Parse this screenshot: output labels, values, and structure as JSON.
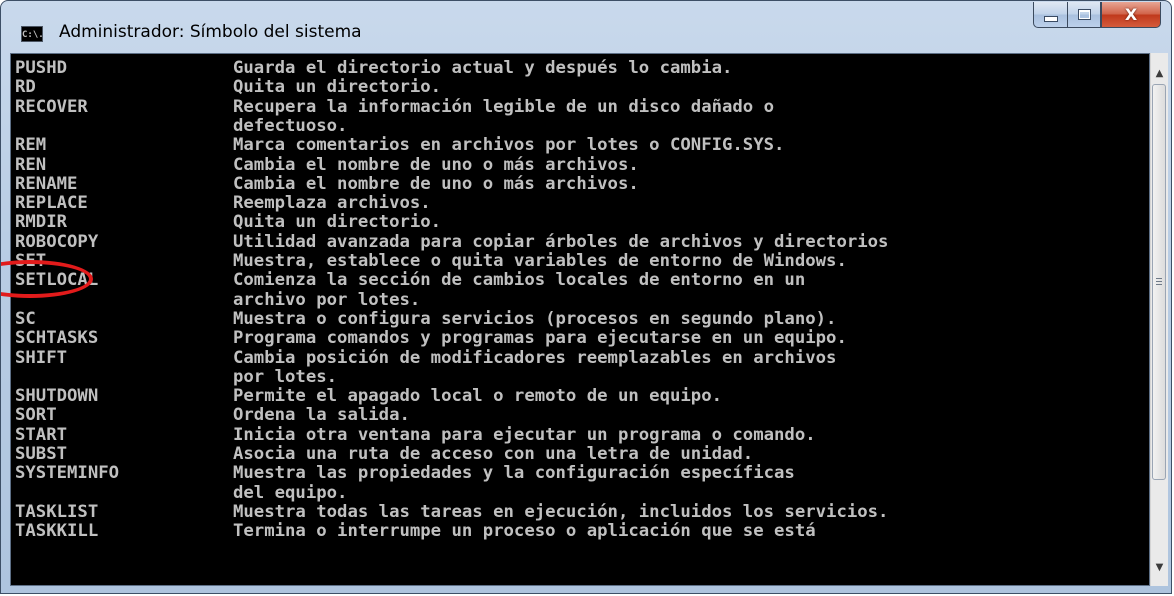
{
  "window": {
    "title": "Administrador: Símbolo del sistema",
    "icon": "cmd-app-icon",
    "icon_text": "C:\\.",
    "minimize_icon": "minimize-icon",
    "maximize_icon": "maximize-icon",
    "close_label": "X"
  },
  "console": {
    "lines": [
      {
        "cmd": "PUSHD",
        "desc": "Guarda el directorio actual y después lo cambia."
      },
      {
        "cmd": "RD",
        "desc": "Quita un directorio."
      },
      {
        "cmd": "RECOVER",
        "desc": "Recupera la información legible de un disco dañado o"
      },
      {
        "cmd": "",
        "desc": "defectuoso."
      },
      {
        "cmd": "REM",
        "desc": "Marca comentarios en archivos por lotes o CONFIG.SYS."
      },
      {
        "cmd": "REN",
        "desc": "Cambia el nombre de uno o más archivos."
      },
      {
        "cmd": "RENAME",
        "desc": "Cambia el nombre de uno o más archivos."
      },
      {
        "cmd": "REPLACE",
        "desc": "Reemplaza archivos."
      },
      {
        "cmd": "RMDIR",
        "desc": "Quita un directorio."
      },
      {
        "cmd": "ROBOCOPY",
        "desc": "Utilidad avanzada para copiar árboles de archivos y directorios"
      },
      {
        "cmd": "SET",
        "desc": "Muestra, establece o quita variables de entorno de Windows."
      },
      {
        "cmd": "SETLOCAL",
        "desc": "Comienza la sección de cambios locales de entorno en un"
      },
      {
        "cmd": "",
        "desc": "archivo por lotes."
      },
      {
        "cmd": "SC",
        "desc": "Muestra o configura servicios (procesos en segundo plano)."
      },
      {
        "cmd": "SCHTASKS",
        "desc": "Programa comandos y programas para ejecutarse en un equipo."
      },
      {
        "cmd": "SHIFT",
        "desc": "Cambia posición de modificadores reemplazables en archivos"
      },
      {
        "cmd": "",
        "desc": "por lotes."
      },
      {
        "cmd": "SHUTDOWN",
        "desc": "Permite el apagado local o remoto de un equipo."
      },
      {
        "cmd": "SORT",
        "desc": "Ordena la salida."
      },
      {
        "cmd": "START",
        "desc": "Inicia otra ventana para ejecutar un programa o comando."
      },
      {
        "cmd": "SUBST",
        "desc": "Asocia una ruta de acceso con una letra de unidad."
      },
      {
        "cmd": "SYSTEMINFO",
        "desc": "Muestra las propiedades y la configuración específicas"
      },
      {
        "cmd": "",
        "desc": "del equipo."
      },
      {
        "cmd": "TASKLIST",
        "desc": "Muestra todas las tareas en ejecución, incluidos los servicios."
      },
      {
        "cmd": "TASKKILL",
        "desc": "Termina o interrumpe un proceso o aplicación que se está"
      }
    ],
    "text_color": "#c0c0c0",
    "background_color": "#000000"
  },
  "scrollbar": {
    "up_icon": "scroll-up-arrow-icon",
    "down_icon": "scroll-down-arrow-icon",
    "up_glyph": "▲",
    "down_glyph": "▼"
  },
  "annotation": {
    "shape": "ellipse",
    "color": "#e21b1b",
    "highlighted_command": "SET"
  }
}
